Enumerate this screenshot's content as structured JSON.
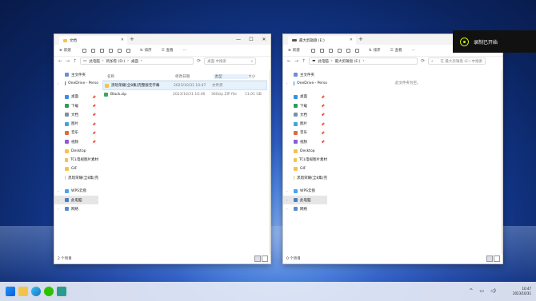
{
  "toast": {
    "text": "录制已开始"
  },
  "left_window": {
    "tab_title": "文档",
    "cmd": {
      "new": "新建",
      "sort": "排序",
      "view": "查看",
      "more": "···"
    },
    "breadcrumb": [
      "此电脑",
      "新加卷 (D:)",
      "桌面"
    ],
    "search_placeholder": "桌面 中搜索",
    "sidebar": {
      "home": "主文件夹",
      "onedrive": "OneDrive - Perso",
      "quick": [
        "桌面",
        "下载",
        "文档",
        "图片",
        "音乐",
        "视频",
        "Desktop",
        "TCL电视图片素材",
        "GIF",
        "黑暗荣耀(全8集)完"
      ],
      "wps": "WPS云盘",
      "pc": "此电脑",
      "net": "网络"
    },
    "columns": {
      "name": "名称",
      "date": "修改日期",
      "type": "类型",
      "size": "大小"
    },
    "files": [
      {
        "name": "黑暗荣耀(全8集)完整版无字幕",
        "date": "2023/10/31 10:47",
        "type": "文件夹",
        "size": ""
      },
      {
        "name": "Black.zip",
        "date": "2023/10/31 10:46",
        "type": "360zip ZIP file",
        "size": "11.01 GB"
      }
    ],
    "status": "2 个项目"
  },
  "right_window": {
    "tab_title": "最大剪辑盘 (E:)",
    "cmd": {
      "new": "新建",
      "sort": "排序",
      "view": "查看",
      "more": "···"
    },
    "breadcrumb": [
      "此电脑",
      "最大剪辑盘 (E:)"
    ],
    "search_placeholder": "在 最大剪辑盘 (E:) 中搜索",
    "empty_text": "此文件夹为空。",
    "sidebar": {
      "home": "主文件夹",
      "onedrive": "OneDrive - Perso",
      "quick": [
        "桌面",
        "下载",
        "文档",
        "图片",
        "音乐",
        "视频",
        "Desktop",
        "TCL电视图片素材",
        "GIF",
        "黑暗荣耀(全8集)完"
      ],
      "wps": "WPS云盘",
      "pc": "此电脑",
      "net": "网络"
    },
    "status": "0 个项目"
  },
  "taskbar": {
    "time": "10:47",
    "date": "2023/10/31"
  },
  "colors": {
    "accent": "#0067c0",
    "folder": "#f3c44c",
    "toast_ring": "#c7f000"
  }
}
